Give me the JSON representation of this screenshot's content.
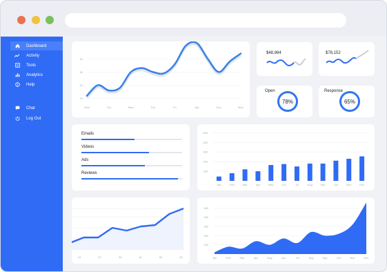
{
  "colors": {
    "accent": "#2f6bf5",
    "dot_red": "#e9734f",
    "dot_yellow": "#f1c13f",
    "dot_green": "#7ac05a"
  },
  "browser": {
    "url": ""
  },
  "sidebar": {
    "items": [
      {
        "label": "Dashboard",
        "icon": "home-icon"
      },
      {
        "label": "Activity",
        "icon": "activity-icon"
      },
      {
        "label": "Tools",
        "icon": "tools-icon"
      },
      {
        "label": "Analytics",
        "icon": "analytics-icon"
      },
      {
        "label": "Help",
        "icon": "help-icon"
      },
      {
        "label": "Chat",
        "icon": "chat-icon"
      },
      {
        "label": "Log Out",
        "icon": "power-icon"
      }
    ]
  },
  "stats": [
    {
      "value": "$48,984"
    },
    {
      "value": "$78,152"
    }
  ],
  "gauges": [
    {
      "label": "Open",
      "value": "78%"
    },
    {
      "label": "Response",
      "value": "65%"
    }
  ],
  "progress": [
    {
      "label": "Emails",
      "value": 0.53
    },
    {
      "label": "Videos",
      "value": 0.67
    },
    {
      "label": "Ads",
      "value": 0.63
    },
    {
      "label": "Reviews",
      "value": 0.96
    }
  ],
  "chart_data": [
    {
      "type": "line",
      "categories": [
        "Mon",
        "Tue",
        "Wed",
        "Thu",
        "Fri",
        "Sat",
        "Sun",
        "Mon"
      ],
      "yticks": [
        "10",
        "20",
        "30",
        "40"
      ],
      "x": [
        0,
        0.5,
        1,
        1.5,
        2,
        2.5,
        3,
        3.5,
        4,
        4.5,
        5,
        5.5,
        6,
        6.5,
        7
      ],
      "values": [
        12,
        20,
        16,
        18,
        30,
        33,
        30,
        29,
        36,
        50,
        52,
        40,
        30,
        38,
        44
      ],
      "ylim": [
        5,
        48
      ],
      "grid": true
    },
    {
      "type": "bar",
      "categories": [
        "Jan",
        "Feb",
        "Mar",
        "Apr",
        "May",
        "Jun",
        "Jul",
        "Aug",
        "Sep",
        "Oct",
        "Nov",
        "Dec"
      ],
      "values": [
        45,
        80,
        120,
        100,
        165,
        175,
        150,
        180,
        180,
        210,
        230,
        255
      ],
      "yticks": [
        "100",
        "200",
        "300",
        "400",
        "500"
      ],
      "ylim": [
        0,
        560
      ],
      "grid": true
    },
    {
      "type": "line",
      "categories": [
        "10",
        "20",
        "30",
        "40",
        "50",
        "60"
      ],
      "values": [
        10,
        18,
        18,
        32,
        28,
        34,
        36,
        52,
        60
      ],
      "ylim": [
        0,
        70
      ],
      "grid": true
    },
    {
      "type": "area",
      "categories": [
        "Jan",
        "Feb",
        "Mar",
        "Apr",
        "May",
        "Jun",
        "Jul",
        "Aug",
        "Sep",
        "Oct",
        "Nov",
        "Dec"
      ],
      "values": [
        20,
        80,
        60,
        140,
        100,
        170,
        120,
        240,
        200,
        220,
        320,
        560
      ],
      "yticks": [
        "100",
        "200",
        "300",
        "400",
        "500"
      ],
      "ylim": [
        0,
        600
      ],
      "grid": true
    }
  ]
}
